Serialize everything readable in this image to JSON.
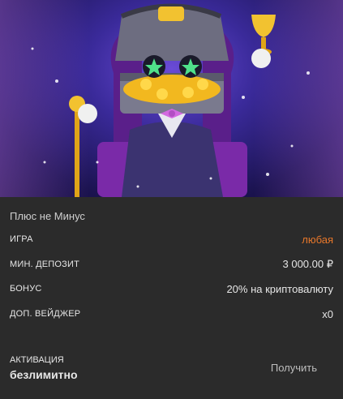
{
  "offer": {
    "title": "Плюс не Минус",
    "game_label": "ИГРА",
    "game_value": "любая",
    "min_deposit_label": "МИН. ДЕПОЗИТ",
    "min_deposit_value": "3 000.00 ₽",
    "bonus_label": "БОНУС",
    "bonus_value": "20% на криптовалюту",
    "wager_label": "ДОП. ВЕЙДЖЕР",
    "wager_value": "x0",
    "activation_label": "АКТИВАЦИЯ",
    "activation_value": "безлимитно",
    "get_button": "Получить"
  },
  "colors": {
    "accent": "#e8772a",
    "background": "#2b2b2b"
  }
}
